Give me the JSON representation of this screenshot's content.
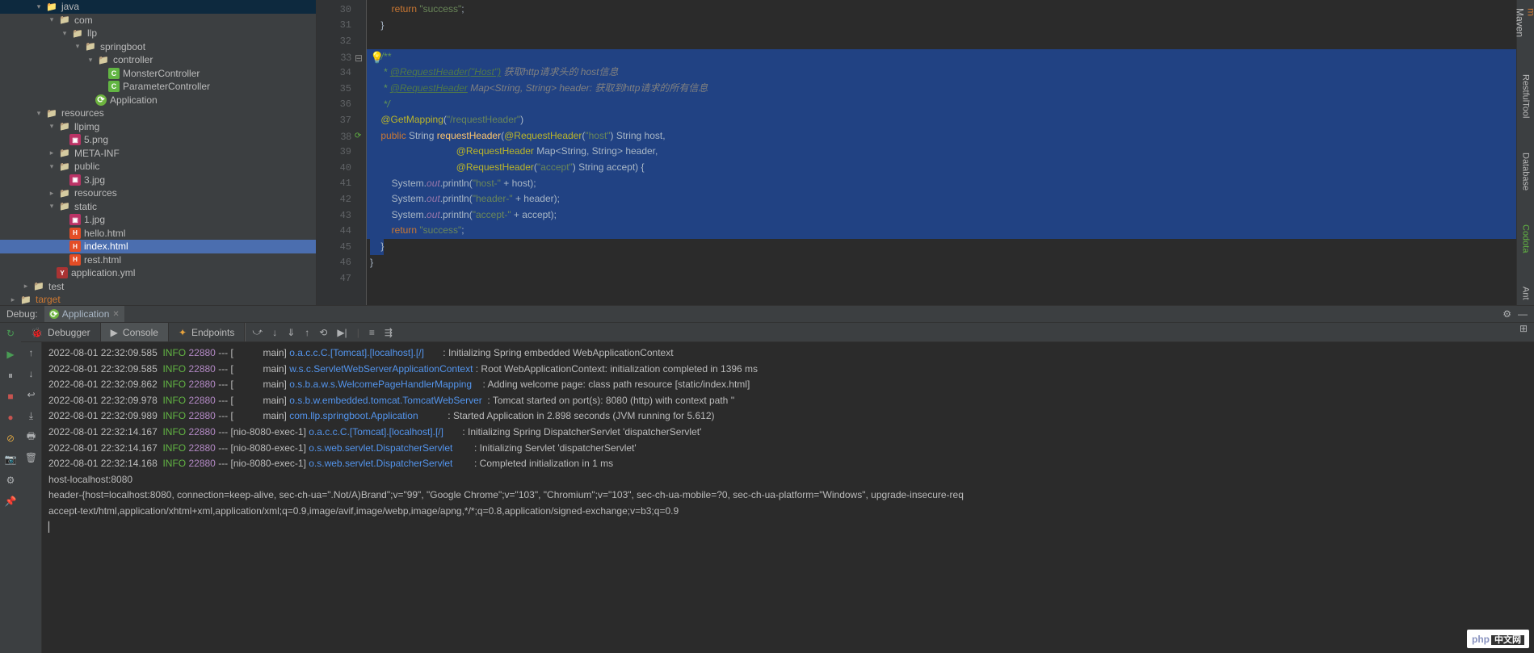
{
  "tree": {
    "java": "java",
    "com": "com",
    "llp": "llp",
    "springboot": "springboot",
    "controller": "controller",
    "monster": "MonsterController",
    "parameter": "ParameterController",
    "application": "Application",
    "resources": "resources",
    "llpimg": "llpimg",
    "png5": "5.png",
    "metainf": "META-INF",
    "public": "public",
    "jpg3": "3.jpg",
    "resources2": "resources",
    "static": "static",
    "jpg1": "1.jpg",
    "hello": "hello.html",
    "index": "index.html",
    "rest": "rest.html",
    "appyml": "application.yml",
    "test": "test",
    "target": "target"
  },
  "gutter": [
    "30",
    "31",
    "32",
    "33",
    "34",
    "35",
    "36",
    "37",
    "38",
    "39",
    "40",
    "41",
    "42",
    "43",
    "44",
    "45",
    "46",
    "47"
  ],
  "code": {
    "l30_kw": "return",
    "l30_str": " \"success\"",
    "l30_end": ";",
    "l31": "}",
    "l33": "/**",
    "l34_a": " * ",
    "l34_ann": "@RequestHeader(\"Host\")",
    "l34_c": " 获取http请求头的 host信息",
    "l35_a": " * ",
    "l35_ann": "@RequestHeader",
    "l35_b": " Map<String, String> header: ",
    "l35_c": "获取到http请求的所有信息",
    "l36": " */",
    "l37_ann": "@GetMapping",
    "l37_p": "(",
    "l37_str": "\"/requestHeader\"",
    "l37_e": ")",
    "l38_pub": "public",
    "l38_str": " String ",
    "l38_meth": "requestHeader",
    "l38_p": "(",
    "l38_ann": "@RequestHeader",
    "l38_p2": "(",
    "l38_s": "\"host\"",
    "l38_p3": ") String host,",
    "l39_ann": "@RequestHeader",
    "l39_r": " Map<String, String> header,",
    "l40_ann": "@RequestHeader",
    "l40_p": "(",
    "l40_s": "\"accept\"",
    "l40_r": ") String accept) {",
    "l41_a": "System.",
    "l41_out": "out",
    "l41_b": ".println(",
    "l41_s": "\"host-\"",
    "l41_c": " + host);",
    "l42_a": "System.",
    "l42_out": "out",
    "l42_b": ".println(",
    "l42_s": "\"header-\"",
    "l42_c": " + header);",
    "l43_a": "System.",
    "l43_out": "out",
    "l43_b": ".println(",
    "l43_s": "\"accept-\"",
    "l43_c": " + accept);",
    "l44_kw": "return",
    "l44_s": " \"success\"",
    "l44_e": ";",
    "l45": "}",
    "l46": "}"
  },
  "right": {
    "maven": "Maven",
    "restful": "RestfulTool",
    "database": "Database",
    "codota": "Codota",
    "ant": "Ant"
  },
  "debug": {
    "label": "Debug:",
    "tab": "Application"
  },
  "subtabs": {
    "debugger": "Debugger",
    "console": "Console",
    "endpoints": "Endpoints"
  },
  "logs": [
    {
      "ts": "2022-08-01 22:32:09.585",
      "lvl": "INFO",
      "pid": "22880",
      "th": "--- [           main]",
      "lg": "o.a.c.c.C.[Tomcat].[localhost].[/]",
      "sp": "       ",
      "msg": ": Initializing Spring embedded WebApplicationContext"
    },
    {
      "ts": "2022-08-01 22:32:09.585",
      "lvl": "INFO",
      "pid": "22880",
      "th": "--- [           main]",
      "lg": "w.s.c.ServletWebServerApplicationContext",
      "sp": " ",
      "msg": ": Root WebApplicationContext: initialization completed in 1396 ms"
    },
    {
      "ts": "2022-08-01 22:32:09.862",
      "lvl": "INFO",
      "pid": "22880",
      "th": "--- [           main]",
      "lg": "o.s.b.a.w.s.WelcomePageHandlerMapping",
      "sp": "    ",
      "msg": ": Adding welcome page: class path resource [static/index.html]"
    },
    {
      "ts": "2022-08-01 22:32:09.978",
      "lvl": "INFO",
      "pid": "22880",
      "th": "--- [           main]",
      "lg": "o.s.b.w.embedded.tomcat.TomcatWebServer",
      "sp": "  ",
      "msg": ": Tomcat started on port(s): 8080 (http) with context path ''"
    },
    {
      "ts": "2022-08-01 22:32:09.989",
      "lvl": "INFO",
      "pid": "22880",
      "th": "--- [           main]",
      "lg": "com.llp.springboot.Application",
      "sp": "           ",
      "msg": ": Started Application in 2.898 seconds (JVM running for 5.612)"
    },
    {
      "ts": "2022-08-01 22:32:14.167",
      "lvl": "INFO",
      "pid": "22880",
      "th": "--- [nio-8080-exec-1]",
      "lg": "o.a.c.c.C.[Tomcat].[localhost].[/]",
      "sp": "       ",
      "msg": ": Initializing Spring DispatcherServlet 'dispatcherServlet'"
    },
    {
      "ts": "2022-08-01 22:32:14.167",
      "lvl": "INFO",
      "pid": "22880",
      "th": "--- [nio-8080-exec-1]",
      "lg": "o.s.web.servlet.DispatcherServlet",
      "sp": "        ",
      "msg": ": Initializing Servlet 'dispatcherServlet'"
    },
    {
      "ts": "2022-08-01 22:32:14.168",
      "lvl": "INFO",
      "pid": "22880",
      "th": "--- [nio-8080-exec-1]",
      "lg": "o.s.web.servlet.DispatcherServlet",
      "sp": "        ",
      "msg": ": Completed initialization in 1 ms"
    }
  ],
  "out": {
    "l1": "host-localhost:8080",
    "l2": "header-{host=localhost:8080, connection=keep-alive, sec-ch-ua=\".Not/A)Brand\";v=\"99\", \"Google Chrome\";v=\"103\", \"Chromium\";v=\"103\", sec-ch-ua-mobile=?0, sec-ch-ua-platform=\"Windows\", upgrade-insecure-req",
    "l3": "accept-text/html,application/xhtml+xml,application/xml;q=0.9,image/avif,image/webp,image/apng,*/*;q=0.8,application/signed-exchange;v=b3;q=0.9"
  },
  "watermark": {
    "php": "php",
    "cn": "中文网"
  }
}
